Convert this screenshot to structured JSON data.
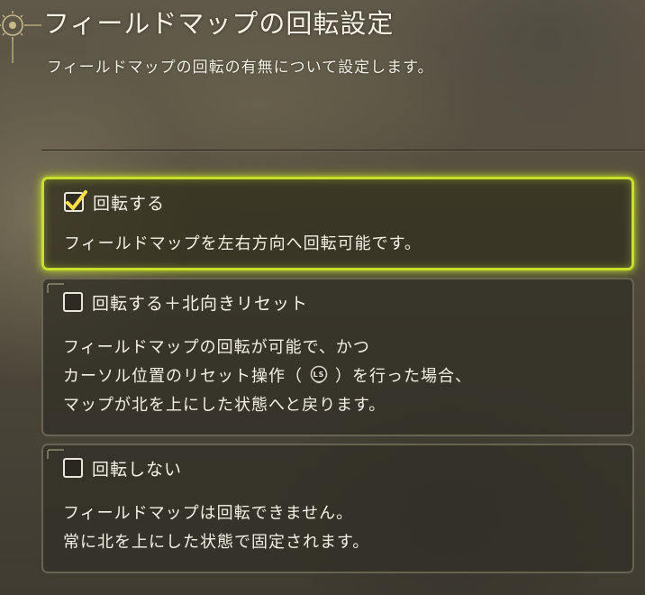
{
  "settings": {
    "title": "フィールドマップの回転設定",
    "description": "フィールドマップの回転の有無について設定します。"
  },
  "options": [
    {
      "label": "回転する",
      "checked": true,
      "desc_lines": [
        "フィールドマップを左右方向へ回転可能です。"
      ]
    },
    {
      "label": "回転する＋北向きリセット",
      "checked": false,
      "desc_lines": [
        "フィールドマップの回転が可能で、かつ",
        "カーソル位置のリセット操作（",
        "）を行った場合、",
        "マップが北を上にした状態へと戻ります。"
      ],
      "button_icon": "ls-stick-icon",
      "button_label": "LS"
    },
    {
      "label": "回転しない",
      "checked": false,
      "desc_lines": [
        "フィールドマップは回転できません。",
        "常に北を上にした状態で固定されます。"
      ]
    }
  ],
  "colors": {
    "highlight": "#c8e02a",
    "text": "#f3f0e6",
    "panel": "#322f26"
  }
}
